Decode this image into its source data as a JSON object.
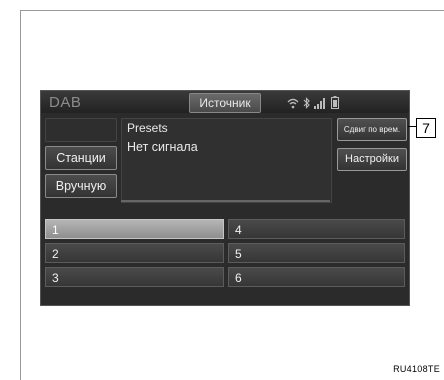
{
  "header": {
    "title": "DAB",
    "source_button": "Источник",
    "status_icons": [
      "wifi-icon",
      "bluetooth-icon",
      "signal-bars-icon",
      "battery-icon"
    ]
  },
  "sidebar": {
    "disabled_label": "",
    "stations_label": "Станции",
    "manual_label": "Вручную"
  },
  "info": {
    "presets_label": "Presets",
    "status_text": "Нет сигнала"
  },
  "right_buttons": {
    "time_shift_label": "Сдвиг по врем.",
    "settings_label": "Настройки"
  },
  "presets": [
    "1",
    "2",
    "3",
    "4",
    "5",
    "6"
  ],
  "selected_preset": "1",
  "callout": {
    "number": "7"
  },
  "reference_code": "RU4108TE"
}
